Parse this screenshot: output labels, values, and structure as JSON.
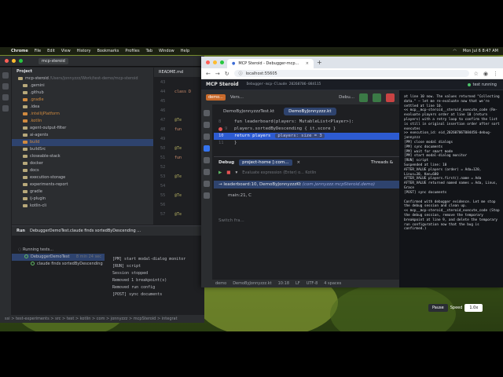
{
  "menubar": {
    "app": "Chrome",
    "items": [
      "File",
      "Edit",
      "View",
      "History",
      "Bookmarks",
      "Profiles",
      "Tab",
      "Window",
      "Help"
    ],
    "clock": "Mon Jul 6  8:47 AM"
  },
  "ide": {
    "project_chip": "mcp-steroid",
    "project_header": "Project",
    "root": "mcp-steroid",
    "root_path": "/Users/jonnyzzz/Work/test-demo/mcp-steroid",
    "tree": [
      ".gemini",
      ".github",
      ".gradle",
      ".idea",
      ".intellijPlatform",
      ".kotlin",
      "agent-output-filter",
      "ai-agents",
      "build",
      "buildSrc",
      "closeable-stack",
      "docker",
      "docs",
      "execution-storage",
      "experiments-report",
      "gradle",
      "ij-plugin",
      "kotlin-cli"
    ],
    "editor_tab": "README.md",
    "line_numbers": [
      "43",
      "44",
      "45",
      "46",
      "47",
      "48",
      "49",
      "50",
      "51",
      "52",
      "53",
      "54",
      "55",
      "56",
      "57"
    ],
    "code": [
      "class D",
      "@Te",
      "fun",
      "@Te",
      "fun",
      "@Te",
      "@Te",
      "@Te"
    ],
    "run_label": "Run",
    "run_config": "DebuggerDemoTest.claude finds sortedByDescending ...",
    "tests_running": "Running tests...",
    "test_class": "DebuggerDemoTest",
    "test_class_time": "8 min 24 sec",
    "test_method": "claude finds sortedByDescending",
    "console": [
      "[PM] start modal-dialog monitor",
      "[RUN] script",
      "Session stopped",
      "Removed 1 breakpoint(s)",
      "Removed run config",
      "[POST] sync documents"
    ],
    "status_path": "ssi > test-experiments > src > test > kotlin > com > jonnyzzz > mcpSteroid > integrat"
  },
  "browser": {
    "tab_title": "MCP Steroid - Debugger-mcp...",
    "url": "localhost:55605"
  },
  "app": {
    "title": "MCP Steroid",
    "session": "Debugger-mcp-Claude 20260706-084115",
    "status": "test running"
  },
  "nested": {
    "project_chip": "demo...",
    "vcs": "Vers...",
    "run_target": "Debu...",
    "tabs": [
      "DemoByJonnyzzzTest.kt",
      "DemoByJonnyzzz.kt"
    ],
    "code_lines": [
      {
        "ln": "8",
        "text": "fun leaderboard(players: MutableList<Player>): "
      },
      {
        "ln": "9",
        "text": "    players.sortedByDescending { it.score }"
      },
      {
        "ln": "10",
        "text": "    return players",
        "hint": "players:  size = 3"
      },
      {
        "ln": "11",
        "text": "}"
      }
    ],
    "debug_label": "Debug",
    "debug_project": "project-home [:com...",
    "threads": "Threads &",
    "eval_placeholder": "Evaluate expression (Enter) o... Kotlin",
    "frame_main": "leaderboard:10, DemoByJonnyzzzKt",
    "frame_main_pkg": "(com.jonnyzzz.mcpSteroid.demo)",
    "frame_2": "main:21, C",
    "switch_frames": "Switch fra...",
    "status_items": [
      "demo",
      "DemoByJonnyzzz.kt",
      "10:18",
      "LF",
      "UTF-8",
      "4 spaces"
    ]
  },
  "log": {
    "lines": [
      "at line 10 now. The values returned \"Collecting data.\" — let me re-evaluate now that we're settled at line 10.",
      "<< mcp__mcp-steroid__steroid_execute_code (Re-evaluate players order at line 10 (return players) with a retry loop to confirm the list is still in original insertion order after sort executes",
      ">> execution_id: eid_20260706T084456-debug-jonnyzzz",
      "[PM] close modal dialogs",
      "[PM] sync documents",
      "[PM] wait for smart mode",
      "[PM] start modal-dialog monitor",
      "[RUN] script",
      "Suspended at line: 10",
      "AFTER_VALUE players (order) = Ada=120, Linus=38, Ken=680",
      "AFTER_VALUE players.first().name = Ada",
      "AFTER_VALUE returned named names = Ada, Linus, Grace",
      "[POST] sync documents",
      "",
      "Confirmed with debugger evidence. Let me stop the debug session and clean up.",
      "<< mcp__mcp-steroid__steroid_execute_code (Stop the debug session, remove the temporary breakpoint at line 9, and delete the temporary run configuration now that the bug is confirmed.)"
    ]
  },
  "player": {
    "pause": "Pause",
    "speed_label": "Speed",
    "speed_value": "1.0x"
  }
}
